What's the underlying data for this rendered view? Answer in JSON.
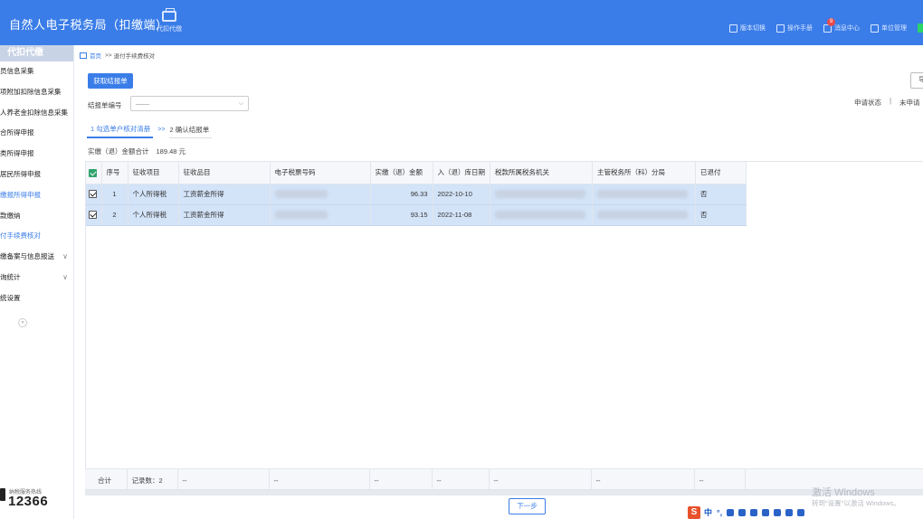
{
  "header": {
    "title": "自然人电子税务局（扣缴端）",
    "module_tab": "代扣代缴",
    "toolbar": [
      {
        "label": "版本切换",
        "icon": "switch-icon"
      },
      {
        "label": "操作手册",
        "icon": "manual-icon"
      },
      {
        "label": "消息中心",
        "icon": "message-icon",
        "badge": "9"
      },
      {
        "label": "单位管理",
        "icon": "building-icon"
      }
    ]
  },
  "sidebar": {
    "heading": "代扣代缴",
    "items": [
      {
        "label": "员信息采集"
      },
      {
        "label": "项附加扣除信息采集"
      },
      {
        "label": "人养老金扣除信息采集"
      },
      {
        "label": "合所得申报"
      },
      {
        "label": "类所得申报"
      },
      {
        "label": "居民所得申报"
      },
      {
        "label": "缴报所得申报",
        "active": true
      },
      {
        "label": "款缴纳"
      },
      {
        "label": "付手续费核对",
        "active": true
      },
      {
        "label": "缴备案与信息报送",
        "chevron": "∨"
      },
      {
        "label": "询统计",
        "chevron": "∨"
      },
      {
        "label": "统设置"
      }
    ],
    "collapse_glyph": "«",
    "hotline_label": "纳税服务热线",
    "hotline_number": "12366"
  },
  "breadcrumb": {
    "home": "首页",
    "separator": ">>",
    "current": "退付手续费核对"
  },
  "actions": {
    "fetch_button": "获取结报单",
    "right_button": "导"
  },
  "filter": {
    "label": "结报单编号",
    "value": "——",
    "apply_state_label": "申请状态",
    "apply_sep": "|",
    "apply_state_value": "未申请"
  },
  "steps": {
    "step1": "1 勾选单户核对清册",
    "sep": ">>",
    "step2": "2 确认结报单"
  },
  "summary": {
    "label": "实缴（退）金额合计",
    "amount": "189.48 元"
  },
  "table": {
    "columns": [
      "序号",
      "征收项目",
      "征收品目",
      "电子税票号码",
      "实缴（退）金额",
      "入（退）库日期",
      "税款所属税务机关",
      "主管税务所（科）分局",
      "已退付"
    ],
    "rows": [
      {
        "index": "1",
        "item": "个人所得税",
        "subitem": "工资薪金所得",
        "amount": "96.33",
        "date": "2022-10-10",
        "paid": "否"
      },
      {
        "index": "2",
        "item": "个人所得税",
        "subitem": "工资薪金所得",
        "amount": "93.15",
        "date": "2022-11-08",
        "paid": "否"
      }
    ],
    "footer": {
      "total_label": "合计",
      "count_label": "记录数：2",
      "dash": "--"
    }
  },
  "next_button": "下一步",
  "watermark": {
    "line1": "激活 Windows",
    "line2": "转到\"设置\"以激活 Windows。"
  },
  "ime": {
    "logo": "S",
    "mode": "中",
    "extra": "°,"
  },
  "colors": {
    "primary": "#3a7de8",
    "selected_row": "#d3e3f8",
    "header_checkbox": "#2fa36b"
  }
}
